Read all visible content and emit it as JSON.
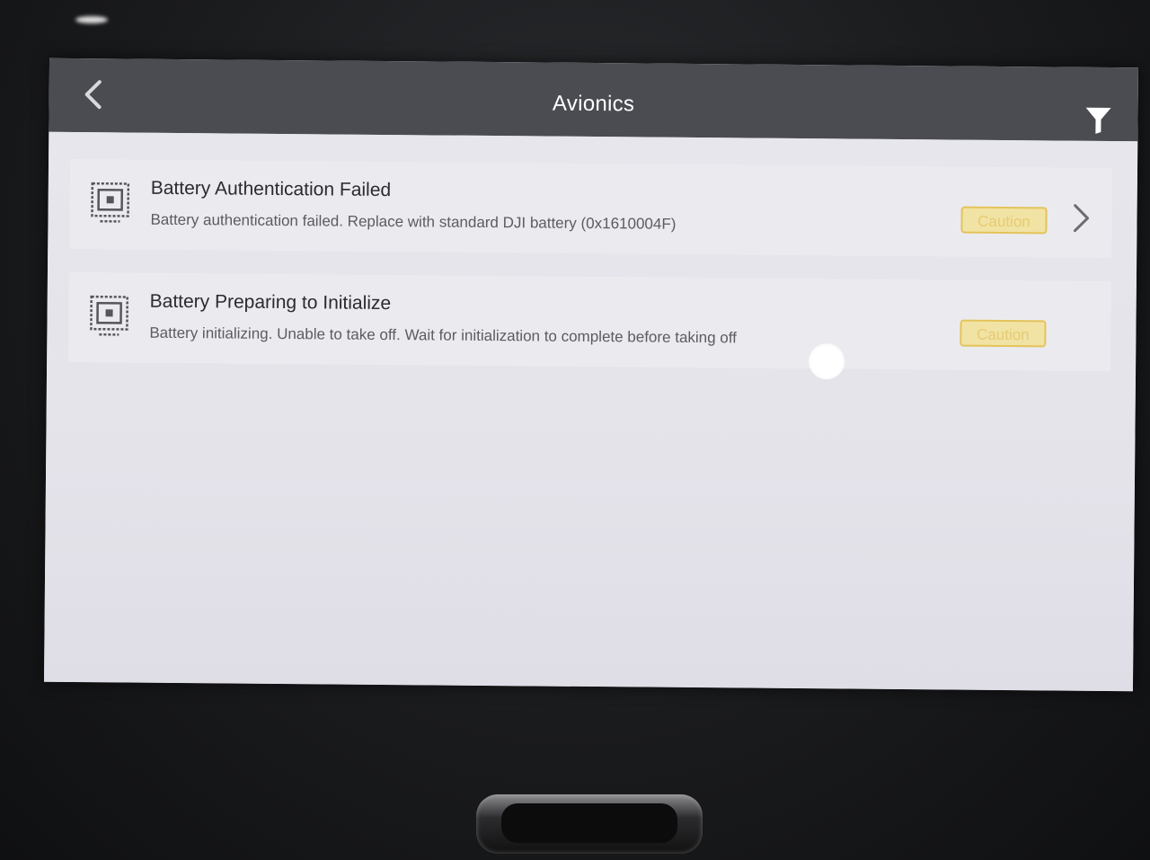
{
  "header": {
    "title": "Avionics"
  },
  "alerts": [
    {
      "title": "Battery Authentication Failed",
      "description": "Battery authentication failed. Replace with standard DJI battery (0x1610004F)",
      "badge": "Caution"
    },
    {
      "title": "Battery Preparing to Initialize",
      "description": "Battery initializing. Unable to take off. Wait for initialization to complete before taking off",
      "badge": "Caution"
    }
  ],
  "colors": {
    "titlebar": "#4a4c51",
    "caution_border": "#e4c35a",
    "caution_text": "#e6cb70"
  },
  "icons": {
    "back": "chevron-left-icon",
    "filter": "filter-icon",
    "alert": "battery-module-icon",
    "detail": "chevron-right-icon"
  }
}
